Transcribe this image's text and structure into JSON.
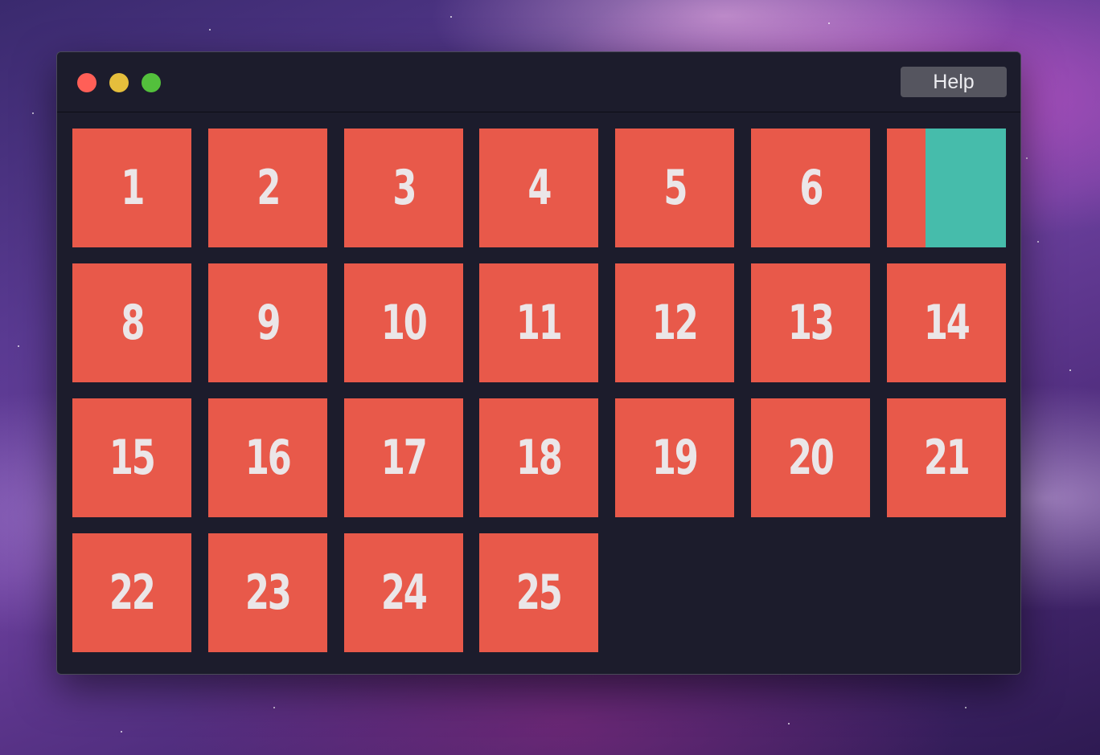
{
  "window": {
    "help_label": "Help"
  },
  "colors": {
    "tile": "#e8594a",
    "tile_text": "#ebe6e8",
    "highlight": "#46bcab",
    "window_bg": "#1c1c2c",
    "help_button_bg": "#55555f"
  },
  "tiles": [
    {
      "label": "1"
    },
    {
      "label": "2"
    },
    {
      "label": "3"
    },
    {
      "label": "4"
    },
    {
      "label": "5"
    },
    {
      "label": "6"
    },
    {
      "label": ""
    },
    {
      "label": "8"
    },
    {
      "label": "9"
    },
    {
      "label": "10"
    },
    {
      "label": "11"
    },
    {
      "label": "12"
    },
    {
      "label": "13"
    },
    {
      "label": "14"
    },
    {
      "label": "15"
    },
    {
      "label": "16"
    },
    {
      "label": "17"
    },
    {
      "label": "18"
    },
    {
      "label": "19"
    },
    {
      "label": "20"
    },
    {
      "label": "21"
    },
    {
      "label": "22"
    },
    {
      "label": "23"
    },
    {
      "label": "24"
    },
    {
      "label": "25"
    }
  ]
}
